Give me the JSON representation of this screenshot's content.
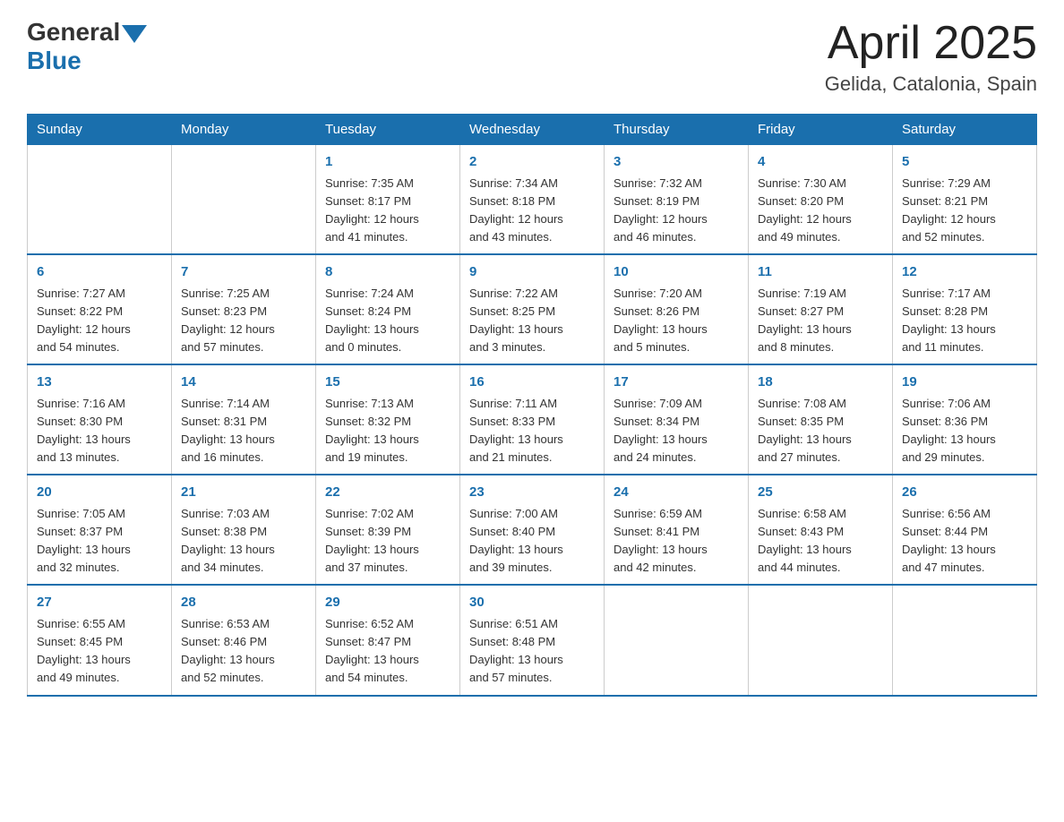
{
  "logo": {
    "general": "General",
    "blue": "Blue"
  },
  "title": "April 2025",
  "subtitle": "Gelida, Catalonia, Spain",
  "headers": [
    "Sunday",
    "Monday",
    "Tuesday",
    "Wednesday",
    "Thursday",
    "Friday",
    "Saturday"
  ],
  "weeks": [
    [
      {
        "day": "",
        "info": ""
      },
      {
        "day": "",
        "info": ""
      },
      {
        "day": "1",
        "info": "Sunrise: 7:35 AM\nSunset: 8:17 PM\nDaylight: 12 hours\nand 41 minutes."
      },
      {
        "day": "2",
        "info": "Sunrise: 7:34 AM\nSunset: 8:18 PM\nDaylight: 12 hours\nand 43 minutes."
      },
      {
        "day": "3",
        "info": "Sunrise: 7:32 AM\nSunset: 8:19 PM\nDaylight: 12 hours\nand 46 minutes."
      },
      {
        "day": "4",
        "info": "Sunrise: 7:30 AM\nSunset: 8:20 PM\nDaylight: 12 hours\nand 49 minutes."
      },
      {
        "day": "5",
        "info": "Sunrise: 7:29 AM\nSunset: 8:21 PM\nDaylight: 12 hours\nand 52 minutes."
      }
    ],
    [
      {
        "day": "6",
        "info": "Sunrise: 7:27 AM\nSunset: 8:22 PM\nDaylight: 12 hours\nand 54 minutes."
      },
      {
        "day": "7",
        "info": "Sunrise: 7:25 AM\nSunset: 8:23 PM\nDaylight: 12 hours\nand 57 minutes."
      },
      {
        "day": "8",
        "info": "Sunrise: 7:24 AM\nSunset: 8:24 PM\nDaylight: 13 hours\nand 0 minutes."
      },
      {
        "day": "9",
        "info": "Sunrise: 7:22 AM\nSunset: 8:25 PM\nDaylight: 13 hours\nand 3 minutes."
      },
      {
        "day": "10",
        "info": "Sunrise: 7:20 AM\nSunset: 8:26 PM\nDaylight: 13 hours\nand 5 minutes."
      },
      {
        "day": "11",
        "info": "Sunrise: 7:19 AM\nSunset: 8:27 PM\nDaylight: 13 hours\nand 8 minutes."
      },
      {
        "day": "12",
        "info": "Sunrise: 7:17 AM\nSunset: 8:28 PM\nDaylight: 13 hours\nand 11 minutes."
      }
    ],
    [
      {
        "day": "13",
        "info": "Sunrise: 7:16 AM\nSunset: 8:30 PM\nDaylight: 13 hours\nand 13 minutes."
      },
      {
        "day": "14",
        "info": "Sunrise: 7:14 AM\nSunset: 8:31 PM\nDaylight: 13 hours\nand 16 minutes."
      },
      {
        "day": "15",
        "info": "Sunrise: 7:13 AM\nSunset: 8:32 PM\nDaylight: 13 hours\nand 19 minutes."
      },
      {
        "day": "16",
        "info": "Sunrise: 7:11 AM\nSunset: 8:33 PM\nDaylight: 13 hours\nand 21 minutes."
      },
      {
        "day": "17",
        "info": "Sunrise: 7:09 AM\nSunset: 8:34 PM\nDaylight: 13 hours\nand 24 minutes."
      },
      {
        "day": "18",
        "info": "Sunrise: 7:08 AM\nSunset: 8:35 PM\nDaylight: 13 hours\nand 27 minutes."
      },
      {
        "day": "19",
        "info": "Sunrise: 7:06 AM\nSunset: 8:36 PM\nDaylight: 13 hours\nand 29 minutes."
      }
    ],
    [
      {
        "day": "20",
        "info": "Sunrise: 7:05 AM\nSunset: 8:37 PM\nDaylight: 13 hours\nand 32 minutes."
      },
      {
        "day": "21",
        "info": "Sunrise: 7:03 AM\nSunset: 8:38 PM\nDaylight: 13 hours\nand 34 minutes."
      },
      {
        "day": "22",
        "info": "Sunrise: 7:02 AM\nSunset: 8:39 PM\nDaylight: 13 hours\nand 37 minutes."
      },
      {
        "day": "23",
        "info": "Sunrise: 7:00 AM\nSunset: 8:40 PM\nDaylight: 13 hours\nand 39 minutes."
      },
      {
        "day": "24",
        "info": "Sunrise: 6:59 AM\nSunset: 8:41 PM\nDaylight: 13 hours\nand 42 minutes."
      },
      {
        "day": "25",
        "info": "Sunrise: 6:58 AM\nSunset: 8:43 PM\nDaylight: 13 hours\nand 44 minutes."
      },
      {
        "day": "26",
        "info": "Sunrise: 6:56 AM\nSunset: 8:44 PM\nDaylight: 13 hours\nand 47 minutes."
      }
    ],
    [
      {
        "day": "27",
        "info": "Sunrise: 6:55 AM\nSunset: 8:45 PM\nDaylight: 13 hours\nand 49 minutes."
      },
      {
        "day": "28",
        "info": "Sunrise: 6:53 AM\nSunset: 8:46 PM\nDaylight: 13 hours\nand 52 minutes."
      },
      {
        "day": "29",
        "info": "Sunrise: 6:52 AM\nSunset: 8:47 PM\nDaylight: 13 hours\nand 54 minutes."
      },
      {
        "day": "30",
        "info": "Sunrise: 6:51 AM\nSunset: 8:48 PM\nDaylight: 13 hours\nand 57 minutes."
      },
      {
        "day": "",
        "info": ""
      },
      {
        "day": "",
        "info": ""
      },
      {
        "day": "",
        "info": ""
      }
    ]
  ]
}
